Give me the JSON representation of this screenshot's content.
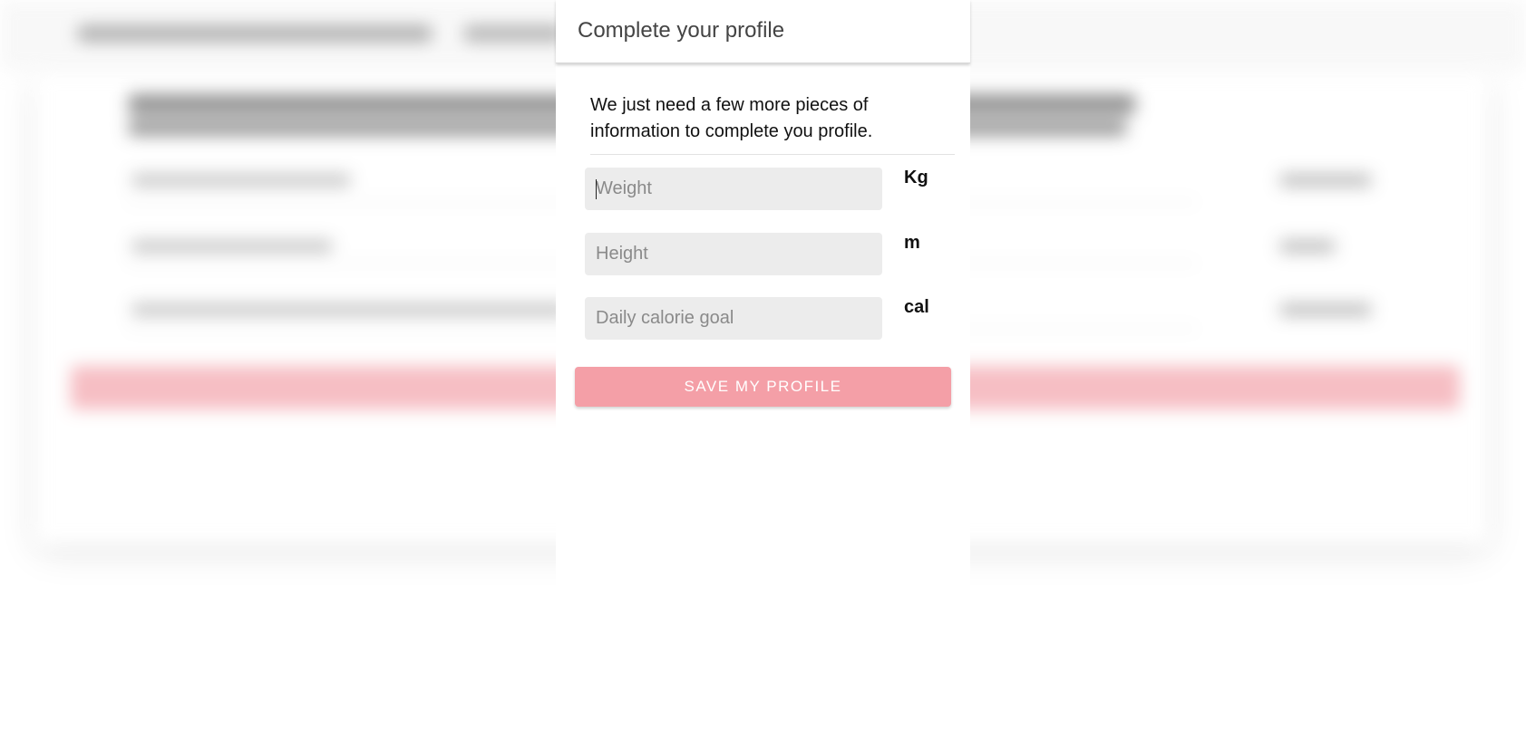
{
  "modal": {
    "title": "Complete your profile",
    "intro": "We just need a few more pieces of information to complete you profile.",
    "fields": [
      {
        "placeholder": "Weight",
        "value": "",
        "unit": "Kg",
        "focused": true
      },
      {
        "placeholder": "Height",
        "value": "",
        "unit": "m",
        "focused": false
      },
      {
        "placeholder": "Daily calorie goal",
        "value": "",
        "unit": "cal",
        "focused": false
      }
    ],
    "save_label": "SAVE MY PROFILE"
  },
  "colors": {
    "save_button": "#f49fa7",
    "input_background": "#ececec",
    "title_text": "#444444"
  }
}
